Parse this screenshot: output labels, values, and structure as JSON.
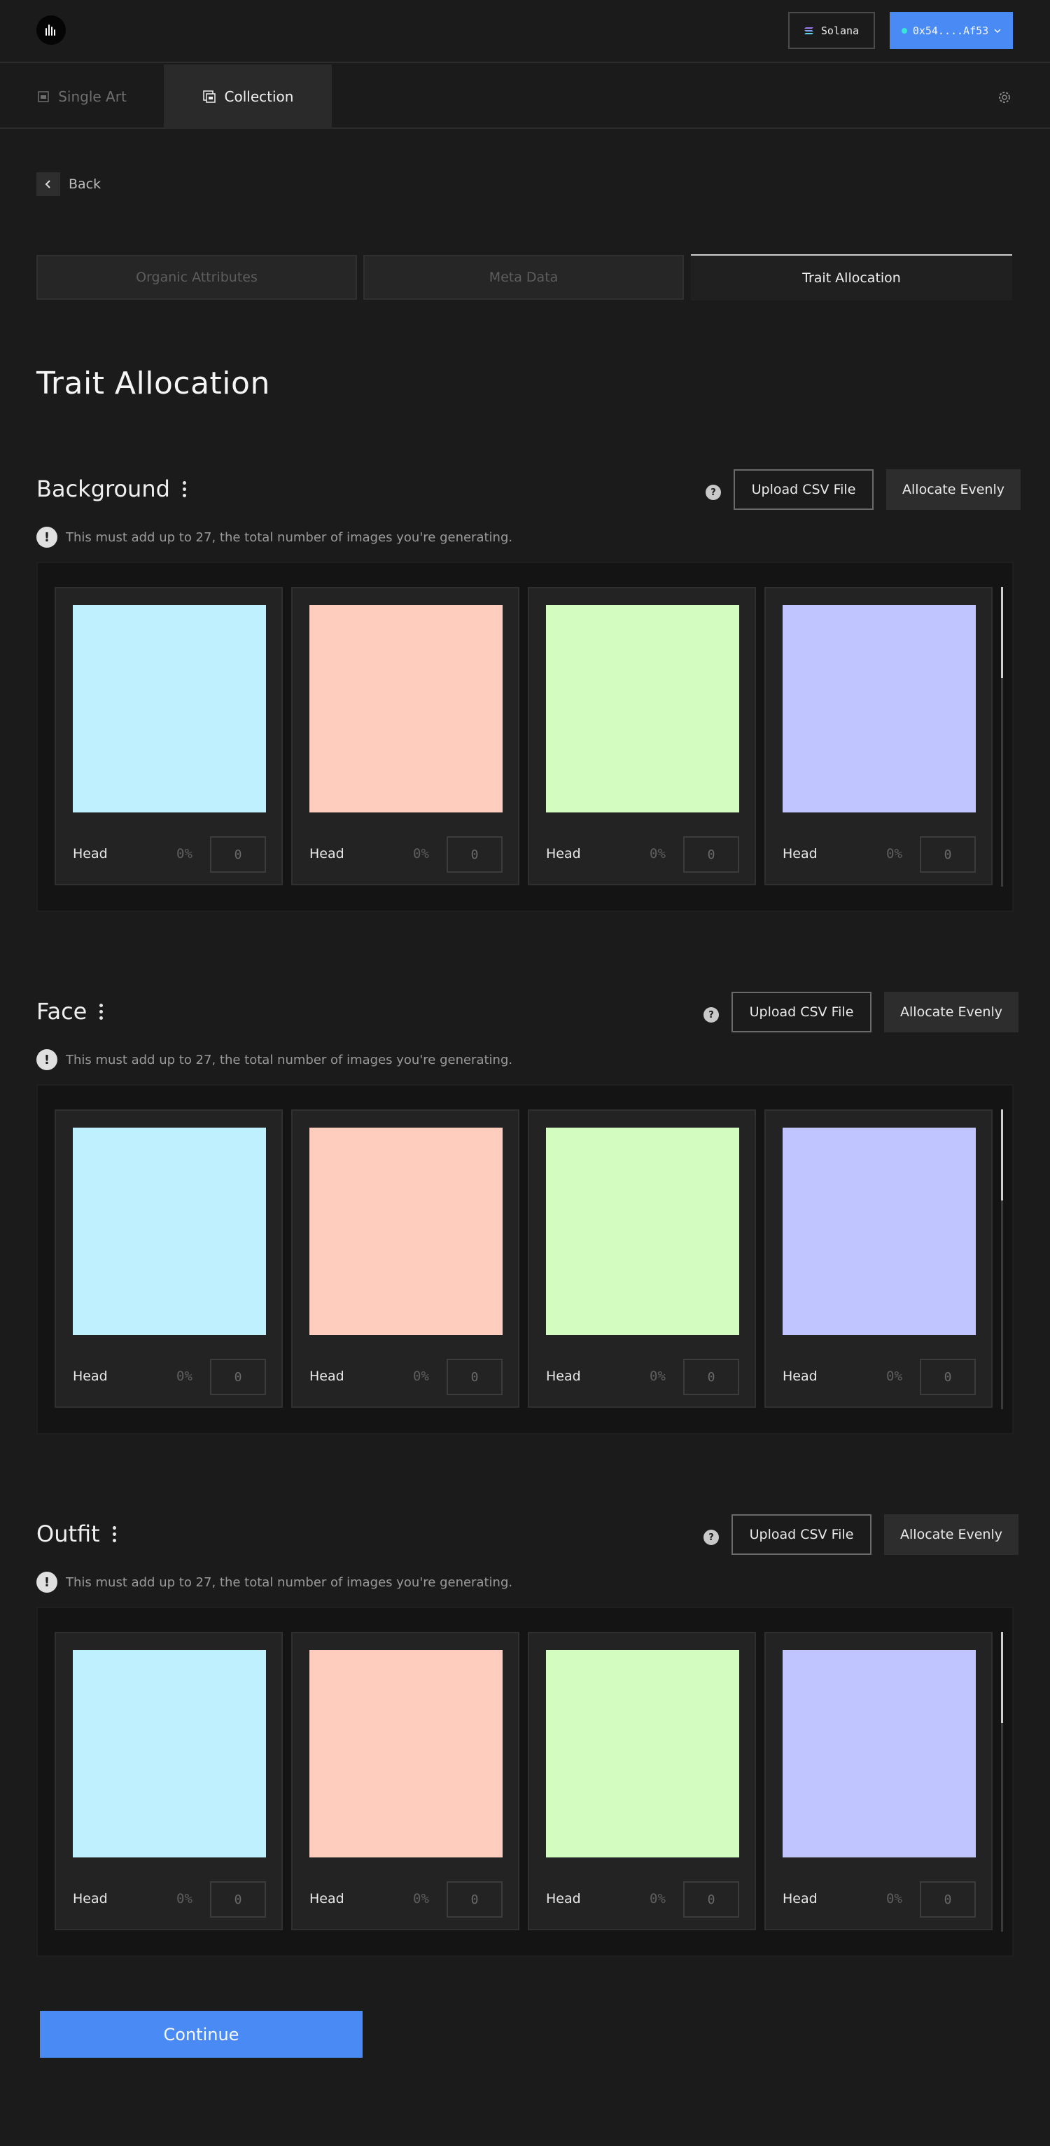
{
  "header": {
    "network_label": "Solana",
    "wallet_label": "0x54....Af53"
  },
  "modes": {
    "single_label": "Single Art",
    "collection_label": "Collection"
  },
  "back_label": "Back",
  "steps": [
    "Organic Attributes",
    "Meta Data",
    "Trait Allocation"
  ],
  "page_title": "Trait Allocation",
  "buttons": {
    "upload_csv": "Upload CSV File",
    "allocate_evenly": "Allocate Evenly",
    "help": "?",
    "continue": "Continue"
  },
  "note_text": "This must add up to 27, the total number of images you're generating.",
  "sections": [
    {
      "title": "Background",
      "cards": [
        {
          "label": "Head",
          "percent": "0%",
          "value": "0",
          "color": "#bff0fe"
        },
        {
          "label": "Head",
          "percent": "0%",
          "value": "0",
          "color": "#ffcdbd"
        },
        {
          "label": "Head",
          "percent": "0%",
          "value": "0",
          "color": "#d3fdc0"
        },
        {
          "label": "Head",
          "percent": "0%",
          "value": "0",
          "color": "#c0c5ff"
        }
      ]
    },
    {
      "title": "Face",
      "cards": [
        {
          "label": "Head",
          "percent": "0%",
          "value": "0",
          "color": "#bff0fe"
        },
        {
          "label": "Head",
          "percent": "0%",
          "value": "0",
          "color": "#ffcdbd"
        },
        {
          "label": "Head",
          "percent": "0%",
          "value": "0",
          "color": "#d3fdc0"
        },
        {
          "label": "Head",
          "percent": "0%",
          "value": "0",
          "color": "#c0c5ff"
        }
      ]
    },
    {
      "title": "Outfit",
      "cards": [
        {
          "label": "Head",
          "percent": "0%",
          "value": "0",
          "color": "#bff0fe"
        },
        {
          "label": "Head",
          "percent": "0%",
          "value": "0",
          "color": "#ffcdbd"
        },
        {
          "label": "Head",
          "percent": "0%",
          "value": "0",
          "color": "#d3fdc0"
        },
        {
          "label": "Head",
          "percent": "0%",
          "value": "0",
          "color": "#c0c5ff"
        }
      ]
    }
  ],
  "colors": {
    "accent": "#4a8af4",
    "background": "#1b1b1b"
  }
}
